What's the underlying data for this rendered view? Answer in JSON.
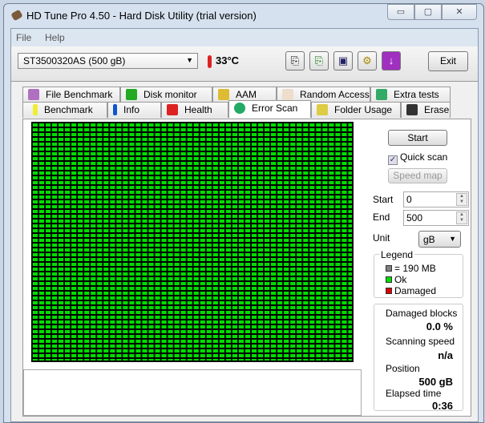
{
  "window": {
    "title": "HD Tune Pro 4.50 - Hard Disk Utility (trial version)",
    "minimize": "▭",
    "maximize": "▢",
    "close": "✕"
  },
  "menu": {
    "file": "File",
    "help": "Help"
  },
  "toolbar": {
    "drive": "ST3500320AS (500 gB)",
    "temperature": "33°C",
    "exit": "Exit"
  },
  "tabs_top": [
    "File Benchmark",
    "Disk monitor",
    "AAM",
    "Random Access",
    "Extra tests"
  ],
  "tabs_bottom": [
    "Benchmark",
    "Info",
    "Health",
    "Error Scan",
    "Folder Usage",
    "Erase"
  ],
  "scan": {
    "start_button": "Start",
    "quick_scan": "Quick scan",
    "quick_scan_checked": true,
    "speed_map": "Speed map",
    "start_label": "Start",
    "start_value": "0",
    "end_label": "End",
    "end_value": "500",
    "unit_label": "Unit",
    "unit_value": "gB"
  },
  "legend": {
    "title": "Legend",
    "block": "= 190 MB",
    "ok": "Ok",
    "damaged": "Damaged",
    "colors": {
      "block": "#808080",
      "ok": "#00dd00",
      "damaged": "#dd0000"
    }
  },
  "stats": {
    "damaged_label": "Damaged blocks",
    "damaged_value": "0.0 %",
    "speed_label": "Scanning speed",
    "speed_value": "n/a",
    "position_label": "Position",
    "position_value": "500 gB",
    "elapsed_label": "Elapsed time",
    "elapsed_value": "0:36"
  }
}
